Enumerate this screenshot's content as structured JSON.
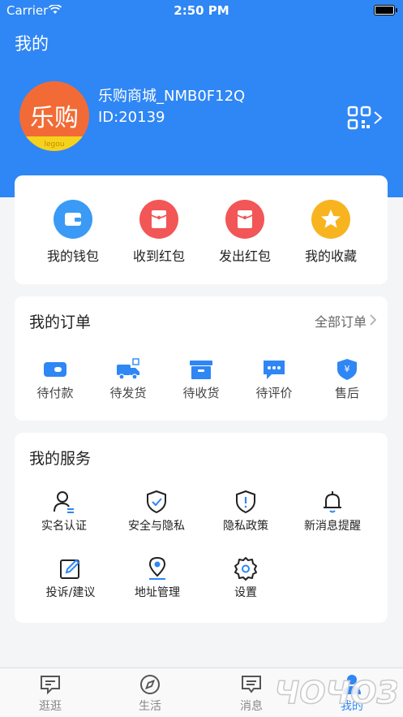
{
  "status_bar": {
    "carrier": "Carrier",
    "time": "2:50 PM"
  },
  "header": {
    "title": "我的"
  },
  "profile": {
    "avatar_brand": "乐购",
    "avatar_sub": "legou",
    "name": "乐购商城_NMB0F12Q",
    "id": "ID:20139"
  },
  "assets": [
    {
      "label": "我的钱包",
      "icon": "wallet-icon",
      "color": "#3a9af5"
    },
    {
      "label": "收到红包",
      "icon": "red-envelope-icon",
      "color": "#f25656"
    },
    {
      "label": "发出红包",
      "icon": "red-envelope-icon",
      "color": "#f25656"
    },
    {
      "label": "我的收藏",
      "icon": "star-icon",
      "color": "#f8b41f"
    }
  ],
  "orders": {
    "title": "我的订单",
    "more": "全部订单",
    "items": [
      {
        "label": "待付款",
        "icon": "wallet-card-icon"
      },
      {
        "label": "待发货",
        "icon": "truck-icon"
      },
      {
        "label": "待收货",
        "icon": "box-icon"
      },
      {
        "label": "待评价",
        "icon": "comment-icon"
      },
      {
        "label": "售后",
        "icon": "shield-yen-icon"
      }
    ],
    "accent": "#2f86f5"
  },
  "services": {
    "title": "我的服务",
    "items": [
      {
        "label": "实名认证",
        "icon": "user-verify-icon"
      },
      {
        "label": "安全与隐私",
        "icon": "shield-check-icon"
      },
      {
        "label": "隐私政策",
        "icon": "shield-info-icon"
      },
      {
        "label": "新消息提醒",
        "icon": "bell-icon"
      },
      {
        "label": "投诉/建议",
        "icon": "edit-icon"
      },
      {
        "label": "地址管理",
        "icon": "location-icon"
      },
      {
        "label": "设置",
        "icon": "gear-icon"
      }
    ]
  },
  "tabbar": {
    "items": [
      {
        "label": "逛逛",
        "icon": "chat-icon"
      },
      {
        "label": "生活",
        "icon": "compass-icon"
      },
      {
        "label": "消息",
        "icon": "message-icon"
      },
      {
        "label": "我的",
        "icon": "person-icon",
        "active": true
      }
    ]
  },
  "watermark": {
    "text": "ЧОЧОЗ"
  }
}
